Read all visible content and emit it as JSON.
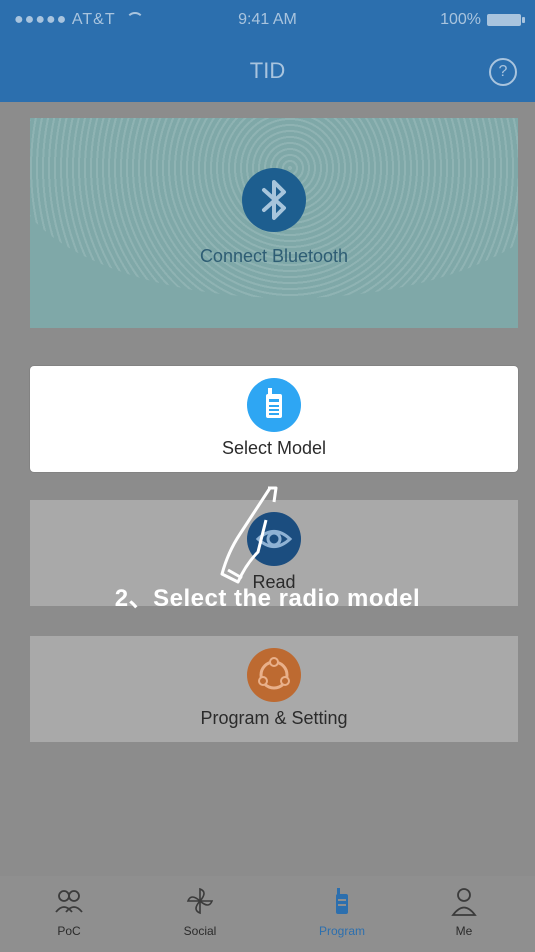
{
  "status": {
    "carrier": "●●●●● AT&T",
    "time": "9:41 AM",
    "battery": "100%"
  },
  "header": {
    "title": "TID",
    "help_label": "?"
  },
  "bluetooth": {
    "label": "Connect Bluetooth"
  },
  "cards": {
    "select_model": "Select Model",
    "read": "Read",
    "program_setting": "Program & Setting"
  },
  "overlay": {
    "instruction": "2、Select the radio model"
  },
  "tabs": [
    {
      "label": "PoC"
    },
    {
      "label": "Social"
    },
    {
      "label": "Program"
    },
    {
      "label": "Me"
    }
  ],
  "colors": {
    "brand": "#2c6fae",
    "overlay": "#8c8c8c",
    "model": "#2ea6f3",
    "read": "#1b4d7f",
    "program": "#bd6a31"
  }
}
